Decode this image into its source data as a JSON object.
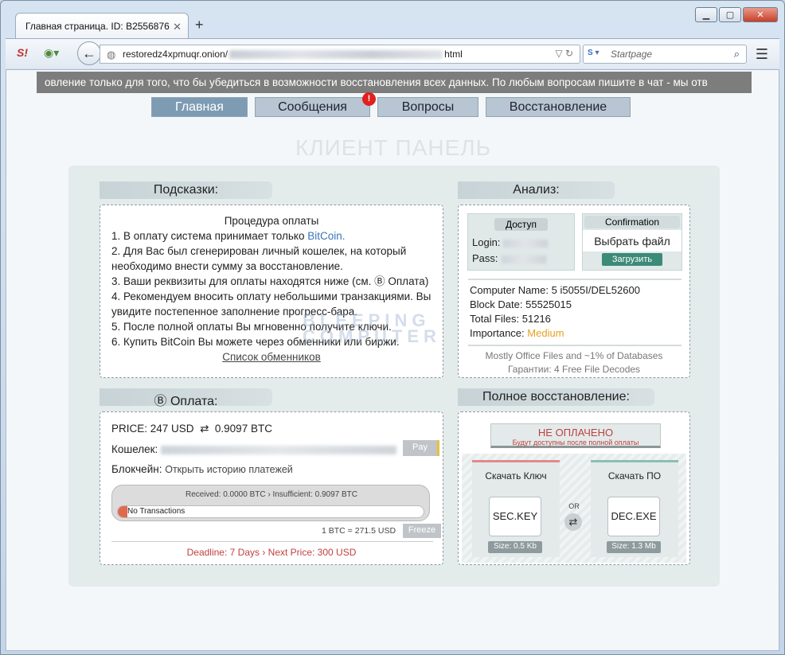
{
  "browser": {
    "tab_title": "Главная страница. ID: B2556876",
    "url_prefix": "restoredz4xpmuqr.onion/",
    "url_suffix": "html",
    "search_placeholder": "Startpage",
    "engine_label": "S"
  },
  "ticker": "овление только для того, что бы убедиться в возможности восстановления всех данных. По любым вопросам пишите в чат - мы отв",
  "menu": {
    "home": "Главная",
    "messages": "Сообщения",
    "messages_badge": "!",
    "questions": "Вопросы",
    "recovery": "Восстановление"
  },
  "panel_title": "КЛИЕНТ ПАНЕЛЬ",
  "hints": {
    "header": "Подсказки:",
    "title": "Процедура оплаты",
    "line1_a": "1. В оплату система принимает только ",
    "line1_b": "BitCoin.",
    "line2": "2. Для Вас был сгенерирован личный кошелек, на который необходимо внести сумму за восстановление.",
    "line3": "3. Ваши реквизиты для оплаты находятся ниже (см. Ⓑ Оплата)",
    "line4": "4. Рекомендуем вносить оплату небольшими транзакциями. Вы увидите постепенное заполнение прогресс-бара.",
    "line5": "5. После полной оплаты Вы мгновенно получите ключи.",
    "line6": "6. Купить BitCoin Вы можете через обменники или биржи.",
    "exchangers_link": "Список обменников"
  },
  "analysis": {
    "header": "Анализ:",
    "access_label": "Доступ",
    "login_label": "Login:",
    "pass_label": "Pass:",
    "confirmation_label": "Confirmation",
    "choose_file": "Выбрать файл",
    "upload_button": "Загрузить",
    "computer_name_label": "Computer Name:",
    "computer_name": "5 i5055I/DEL52600",
    "block_date_label": "Block Date:",
    "block_date": "55525015",
    "total_files_label": "Total Files:",
    "total_files": "51216",
    "importance_label": "Importance:",
    "importance": "Medium",
    "note1": "Mostly Office Files and ~1% of Databases",
    "note2": "Гарантии: 4 Free File Decodes"
  },
  "payment": {
    "header": "Ⓑ Оплата:",
    "price_label": "PRICE:",
    "price_usd": "247 USD",
    "arrows": "⇄",
    "price_btc": "0.9097 BTC",
    "wallet_label": "Кошелек:",
    "pay_button": "Pay",
    "blockchain_label": "Блокчейн:",
    "blockchain_link": "Открыть историю платежей",
    "progress_status": "Received: 0.0000 BTC › Insufficient: 0.9097 BTC",
    "progress_fraction": 0.02,
    "no_transactions": "No Transactions",
    "rate": "1 BTC = 271.5 USD",
    "freeze_button": "Freeze",
    "deadline": "Deadline: 7 Days › Next Price: 300 USD"
  },
  "recovery": {
    "header": "Полное восстановление:",
    "status": "НЕ ОПЛАЧЕНО",
    "status_sub": "Будут доступны после полной оплаты",
    "download_key": "Скачать Ключ",
    "download_software": "Скачать ПО",
    "or_label": "OR",
    "key_file": "SEC.KEY",
    "key_size": "Size: 0.5 Kb",
    "exe_file": "DEC.EXE",
    "exe_size": "Size: 1.3 Mb"
  },
  "watermark": {
    "line1": "BLEEPING",
    "line2": "COMPUTER"
  },
  "colors": {
    "accent_red": "#c04040",
    "importance": "#e6a020",
    "upload_green": "#3c8a78"
  }
}
